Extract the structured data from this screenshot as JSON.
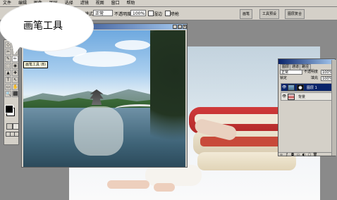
{
  "annotation": {
    "bubble_text": "画笔工具"
  },
  "menubar": {
    "items": [
      "文件",
      "编辑",
      "图像",
      "图层",
      "选择",
      "滤镜",
      "视图",
      "窗口",
      "帮助"
    ]
  },
  "options_bar": {
    "mode_label": "模式",
    "mode_value": "正常",
    "opacity_label": "不透明度",
    "opacity_value": "100%",
    "wet_edges_label": "湿边",
    "airbrush_label": "喷枪",
    "tabs": [
      "画笔",
      "工具预设",
      "图层复合"
    ]
  },
  "toolbox": {
    "tooltip": "画笔工具 (B)",
    "tools": [
      "◇",
      "⌗",
      "✂",
      "◎",
      "✎",
      "✏",
      "⬚",
      "◉",
      "▲",
      "✚",
      "T",
      "↖",
      "▭",
      "✋",
      "🔍",
      "⬛"
    ]
  },
  "photo_window": {
    "title": ""
  },
  "layers_panel": {
    "tabs": [
      "图层",
      "通道",
      "路径"
    ],
    "blend_mode": "正常",
    "opacity_label": "不透明度",
    "opacity_value": "100%",
    "lock_label": "锁定",
    "fill_label": "填充",
    "fill_value": "100%",
    "layers": [
      {
        "name": "图层 1",
        "active": true
      },
      {
        "name": "背景",
        "active": false
      }
    ],
    "footer_icons": [
      "link-icon",
      "fx-icon",
      "mask-icon",
      "set-icon",
      "adjust-icon",
      "new-layer-icon",
      "trash-icon"
    ]
  },
  "colors": {
    "selected_layer": "#0a246a",
    "panel_gray": "#d4d0c8",
    "workspace_gray": "#8a8a8a"
  }
}
